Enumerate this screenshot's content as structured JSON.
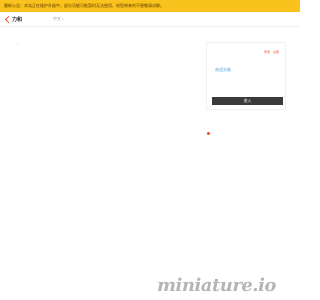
{
  "notice": {
    "text": "最新公告：本站正在维护升级中，部分功能可能暂时无法使用，给您带来的不便敬请谅解。"
  },
  "header": {
    "logo_text": "力和",
    "language": "中文",
    "language_caret": "▾"
  },
  "sidebar_card": {
    "link_login": "登录",
    "link_register": "注册",
    "user_line": "欢迎光临",
    "button_label": "进入"
  },
  "watermark": {
    "text": "miniature.io"
  },
  "colors": {
    "notice_bg": "#f9c21c",
    "accent": "#e8542a",
    "link": "#4aa3df",
    "button_bg": "#3a3a3a"
  }
}
